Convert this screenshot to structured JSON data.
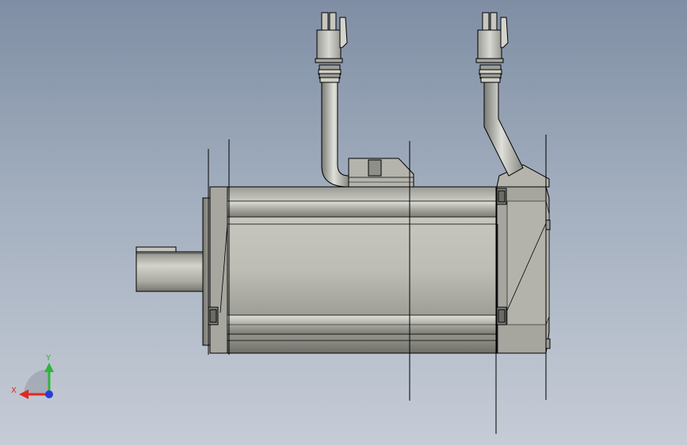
{
  "viewport": {
    "background_top": "#7f8ea4",
    "background_bottom": "#c6ccd6",
    "model_color": "#b9b9b2",
    "edge_color": "#000000"
  },
  "triad": {
    "x_label": "X",
    "y_label": "Y",
    "x_color": "#e0281f",
    "y_color": "#2fb53c",
    "z_color": "#2a3bd8"
  }
}
